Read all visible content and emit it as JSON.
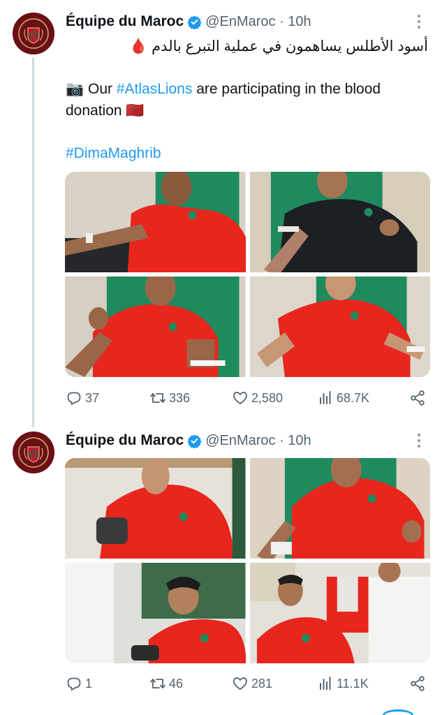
{
  "tweets": [
    {
      "author_name": "Équipe du Maroc",
      "handle_time": "@EnMaroc · 10h",
      "text_arabic": "أسود الأطلس يساهمون في عملية التبرع بالدم 🩸",
      "text_en_prefix": "📷 Our ",
      "text_en_hashtag": "#AtlasLions",
      "text_en_suffix": " are participating in the blood donation 🇲🇦",
      "hashtag_line": "#DimaMaghrib",
      "photos": [
        "player-blood-donation-1",
        "player-blood-donation-2",
        "player-blood-donation-3",
        "player-blood-donation-4"
      ],
      "replies": "37",
      "retweets": "336",
      "likes": "2,580",
      "views": "68.7K"
    },
    {
      "author_name": "Équipe du Maroc",
      "handle_time": "@EnMaroc · 10h",
      "photos": [
        "player-blood-donation-5",
        "player-blood-donation-6",
        "player-blood-donation-7",
        "player-blood-donation-8"
      ],
      "replies": "1",
      "retweets": "46",
      "likes": "281",
      "views": "11.1K"
    }
  ],
  "colors": {
    "accent": "#1d9bf0",
    "muted_text": "#536471",
    "jersey_red": "#e8261e",
    "chair_green": "#1e8a5e",
    "avatar_maroon": "#6b0f17"
  },
  "icons": [
    "verified-badge-icon",
    "more-icon",
    "reply-icon",
    "retweet-icon",
    "like-icon",
    "views-icon",
    "share-icon"
  ]
}
